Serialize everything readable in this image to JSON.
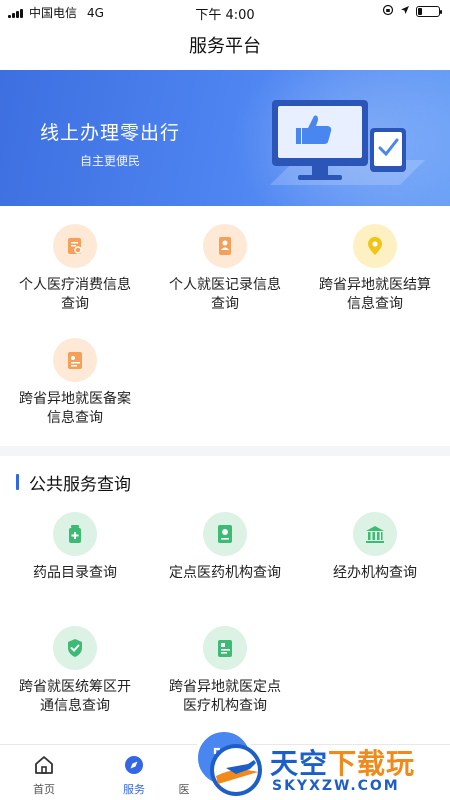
{
  "status_bar": {
    "carrier": "中国电信",
    "network": "4G",
    "time": "下午 4:00"
  },
  "header": {
    "title": "服务平台"
  },
  "banner": {
    "title": "线上办理零出行",
    "subtitle": "自主更便民"
  },
  "services": [
    {
      "label_line1": "个人医疗消费信息",
      "label_line2": "查询",
      "icon": "receipt-search-icon",
      "color": "#f5a05a"
    },
    {
      "label_line1": "个人就医记录信息",
      "label_line2": "查询",
      "icon": "person-record-icon",
      "color": "#f5a05a"
    },
    {
      "label_line1": "跨省异地就医结算",
      "label_line2": "信息查询",
      "icon": "location-pin-icon",
      "color": "#f3c316"
    },
    {
      "label_line1": "跨省异地就医备案",
      "label_line2": "信息查询",
      "icon": "filing-record-icon",
      "color": "#f5a05a"
    }
  ],
  "public_section": {
    "title": "公共服务查询",
    "items": [
      {
        "label_line1": "药品目录查询",
        "label_line2": "",
        "icon": "medicine-bottle-icon",
        "color": "#3dbb74"
      },
      {
        "label_line1": "定点医药机构查询",
        "label_line2": "",
        "icon": "map-marker-icon",
        "color": "#3dbb74"
      },
      {
        "label_line1": "经办机构查询",
        "label_line2": "",
        "icon": "government-building-icon",
        "color": "#3dbb74"
      },
      {
        "label_line1": "跨省就医统筹区开",
        "label_line2": "通信息查询",
        "icon": "shield-check-icon",
        "color": "#3dbb74"
      },
      {
        "label_line1": "跨省异地就医定点",
        "label_line2": "医疗机构查询",
        "icon": "hospital-document-icon",
        "color": "#3dbb74"
      }
    ]
  },
  "tabs": [
    {
      "label": "首页",
      "icon": "home-icon"
    },
    {
      "label": "服务",
      "icon": "compass-icon",
      "active": true
    },
    {
      "label": "医",
      "icon": "partial-icon"
    }
  ],
  "accent_color": "#3467e5",
  "watermark": {
    "text_part1": "天空",
    "text_part2": "下载玩",
    "url": "SKYXZW.COM"
  }
}
